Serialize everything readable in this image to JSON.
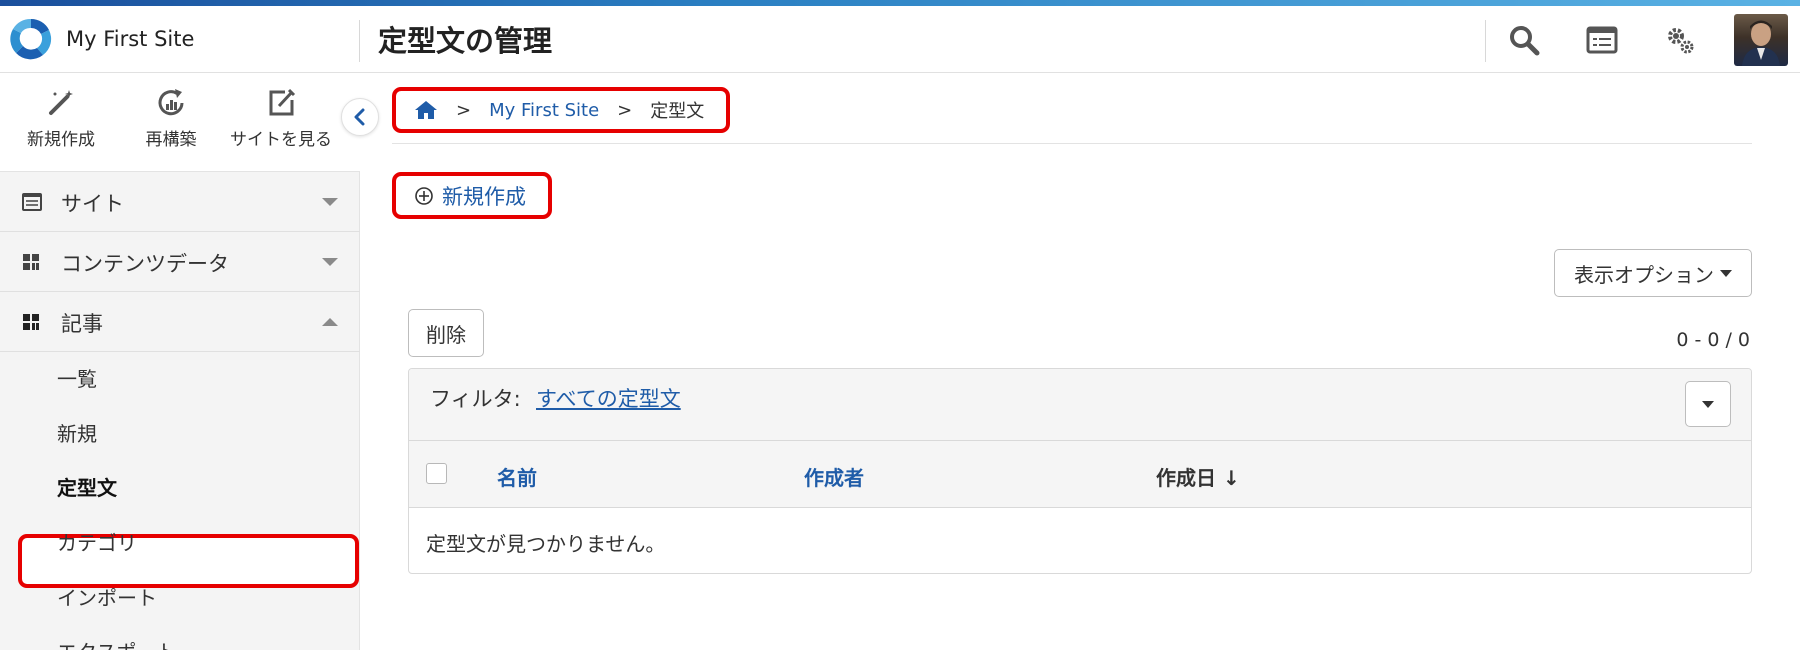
{
  "header": {
    "site_name": "My First Site",
    "page_title": "定型文の管理",
    "icons": [
      "search-icon",
      "list-view-icon",
      "settings-icon",
      "user-avatar"
    ]
  },
  "quick_actions": [
    {
      "label": "新規作成",
      "icon": "pen-icon"
    },
    {
      "label": "再構築",
      "icon": "rebuild-icon"
    },
    {
      "label": "サイトを見る",
      "icon": "external-edit-icon"
    }
  ],
  "sidebar": {
    "groups": [
      {
        "label": "サイト",
        "expanded": false
      },
      {
        "label": "コンテンツデータ",
        "expanded": false
      },
      {
        "label": "記事",
        "expanded": true
      }
    ],
    "items": [
      {
        "label": "一覧"
      },
      {
        "label": "新規"
      },
      {
        "label": "定型文",
        "active": true
      },
      {
        "label": "カテゴリ"
      },
      {
        "label": "インポート"
      },
      {
        "label": "エクスポート"
      }
    ]
  },
  "breadcrumb": {
    "home_icon": "home-icon",
    "sep": ">",
    "site": "My First Site",
    "current": "定型文"
  },
  "actions": {
    "new_label": "新規作成",
    "display_options": "表示オプション",
    "delete": "削除",
    "count": "0 - 0 / 0"
  },
  "filter": {
    "label": "フィルタ:",
    "value": "すべての定型文"
  },
  "table": {
    "columns": [
      "名前",
      "作成者",
      "作成日 ↓"
    ],
    "empty_message": "定型文が見つかりません。"
  },
  "colors": {
    "accent": "#1f5ca8",
    "highlight": "#e60000"
  }
}
